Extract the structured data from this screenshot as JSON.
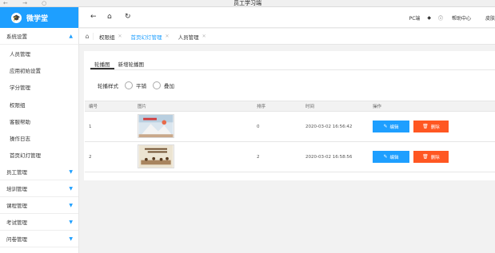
{
  "browser": {
    "title": "员工学习端",
    "nav_glyphs": "← → ○"
  },
  "brand": {
    "name": "微学堂",
    "logo_icon": "graduation-cap-icon"
  },
  "sidebar": {
    "groups": [
      {
        "label": "系统设置",
        "expanded": true,
        "items": [
          "人员管理",
          "应用初始设置",
          "学分管理",
          "权限组",
          "客服帮助",
          "操作日志",
          "首页幻灯管理"
        ]
      },
      {
        "label": "员工管理",
        "expanded": false,
        "items": []
      },
      {
        "label": "培训管理",
        "expanded": false,
        "items": []
      },
      {
        "label": "课程管理",
        "expanded": false,
        "items": []
      },
      {
        "label": "考试管理",
        "expanded": false,
        "items": []
      },
      {
        "label": "问卷管理",
        "expanded": false,
        "items": []
      }
    ]
  },
  "topbar": {
    "back_icon": "←",
    "home_icon": "⌂",
    "refresh_icon": "↻",
    "pc_label": "PC端",
    "help_label": "帮助中心",
    "skin_label": "皮肤"
  },
  "tabs": [
    {
      "label": "权限组",
      "active": false
    },
    {
      "label": "首页幻灯管理",
      "active": true
    },
    {
      "label": "人员管理",
      "active": false
    }
  ],
  "content": {
    "subtabs": [
      "轮播图",
      "新增轮播图"
    ],
    "carousel_style": {
      "label": "轮播样式",
      "options": [
        "平铺",
        "叠加"
      ]
    },
    "table": {
      "headers": [
        "编号",
        "图片",
        "排序",
        "时间",
        "操作"
      ],
      "rows": [
        {
          "id": "1",
          "sort": "0",
          "time": "2020-03-02 16:56:42"
        },
        {
          "id": "2",
          "sort": "2",
          "time": "2020-03-02 16:58:56"
        }
      ],
      "edit_label": "编辑",
      "delete_label": "删除"
    }
  },
  "colors": {
    "primary": "#1e9fff",
    "danger": "#ff5722"
  }
}
